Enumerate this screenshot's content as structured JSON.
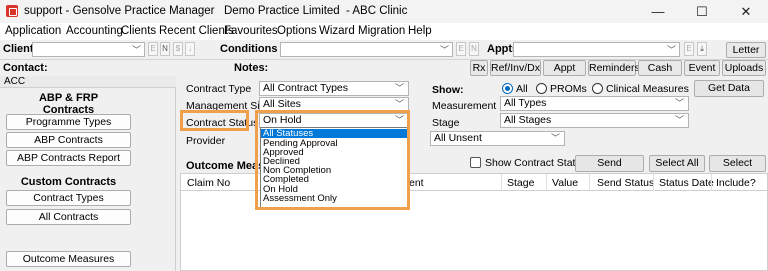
{
  "window": {
    "app_title": "support - Gensolve Practice Manager",
    "practice": "Demo Practice Limited",
    "clinic": "- ABC Clinic",
    "minimize": "—",
    "maximize": "☐",
    "close": "✕"
  },
  "menu": [
    "Application",
    "Accounting",
    "Clients",
    "Recent Clients",
    "Favourites",
    "Options",
    "Wizard",
    "Migration",
    "Help"
  ],
  "toolbar": {
    "client_label": "Client",
    "conditions_label": "Conditions",
    "appts_label": "Appts",
    "letter": "Letter",
    "contact_label": "Contact:",
    "notes_label": "Notes:",
    "buttons": [
      "Rx",
      "Ref/Inv/Dx",
      "Appt Slip",
      "Reminders",
      "Cash Sale",
      "Event",
      "Uploads"
    ]
  },
  "sidebar": {
    "header": "ACC",
    "section1_line1": "ABP & FRP",
    "section1_line2": "Contracts",
    "items1": [
      "Programme Types",
      "ABP Contracts",
      "ABP Contracts Report"
    ],
    "section2": "Custom Contracts",
    "items2": [
      "Contract Types",
      "All Contracts"
    ],
    "bottom": "Outcome Measures"
  },
  "filters": {
    "contract_type_label": "Contract Type",
    "contract_type_value": "All Contract Types",
    "management_site_label": "Management Site",
    "management_site_value": "All Sites",
    "contract_status_label": "Contract Status",
    "contract_status_value": "On Hold",
    "provider_label": "Provider",
    "show_label": "Show:",
    "show_options": [
      "All",
      "PROMs",
      "Clinical Measures"
    ],
    "measurement_label": "Measurement",
    "measurement_value": "All Types",
    "stage_label": "Stage",
    "stage_value": "All Stages",
    "unsent_value": "All Unsent",
    "get_data": "Get Data"
  },
  "status_options": [
    "All Statuses",
    "Pending Approval",
    "Approved",
    "Declined",
    "Non Completion",
    "Completed",
    "On Hold",
    "Assessment Only"
  ],
  "outcome": {
    "title": "Outcome Measures",
    "show_contract_status": "Show Contract Status",
    "send_selected": "Send Selected",
    "select_all": "Select All",
    "select_none": "Select None",
    "columns": [
      "Claim No",
      "ent",
      "Stage",
      "Value",
      "Send Status",
      "Status Date",
      "Include?"
    ]
  },
  "colors": {
    "accent": "#0078d7",
    "highlight": "#f0a04b"
  }
}
